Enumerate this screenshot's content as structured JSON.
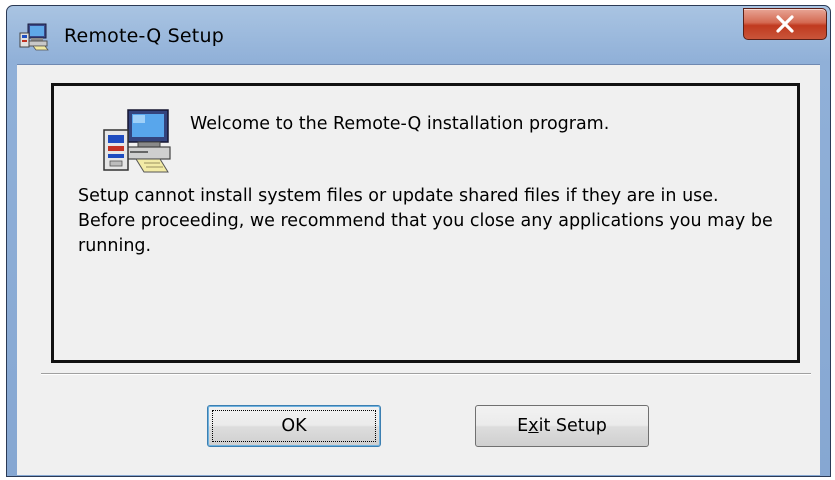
{
  "window": {
    "title": "Remote-Q Setup",
    "icon": "setup-computer-icon",
    "close_icon": "close-x-icon"
  },
  "content": {
    "icon": "setup-computer-icon",
    "welcome": "Welcome to the Remote-Q installation program.",
    "message": "Setup cannot install system files or update shared files if they are in use. Before proceeding, we recommend that you close any applications you may be running."
  },
  "buttons": {
    "ok_label": "OK",
    "exit_label_pre": "E",
    "exit_label_mnemonic": "x",
    "exit_label_post": "it Setup"
  },
  "colors": {
    "titlebar": "#90b0d8",
    "close_button": "#c9553a",
    "dialog_background": "#f0f0f0",
    "frame_border": "#111111"
  }
}
